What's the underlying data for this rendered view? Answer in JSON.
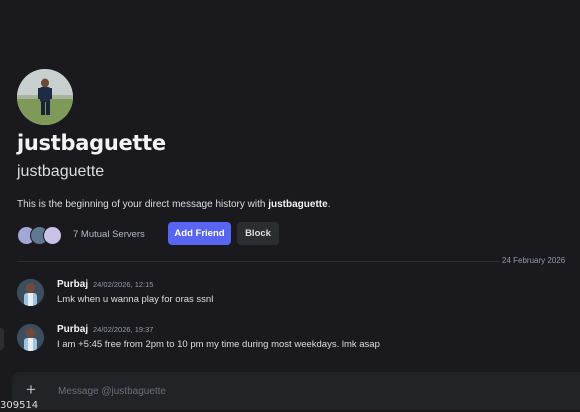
{
  "profile": {
    "display_name": "justbaguette",
    "username": "justbaguette",
    "intro_prefix": "This is the beginning of your direct message history with ",
    "intro_name": "justbaguette",
    "intro_suffix": "."
  },
  "mutual": {
    "label": "7 Mutual Servers"
  },
  "actions": {
    "add_friend_label": "Add Friend",
    "block_label": "Block"
  },
  "divider": {
    "date": "24 February 2026"
  },
  "messages": [
    {
      "author": "Purbaj",
      "time": "24/02/2026, 12:15",
      "text": "Lmk when u wanna play for oras ssnl"
    },
    {
      "author": "Purbaj",
      "time": "24/02/2026, 19:37",
      "text": "I am +5:45 free from 2pm to 10 pm my time during most weekdays. lmk asap"
    }
  ],
  "composer": {
    "placeholder": "Message @justbaguette"
  },
  "overlay": {
    "number": "309514"
  },
  "colors": {
    "background": "#1a1a1e",
    "accent": "#5865f2",
    "block_button": "#2b2d31"
  }
}
